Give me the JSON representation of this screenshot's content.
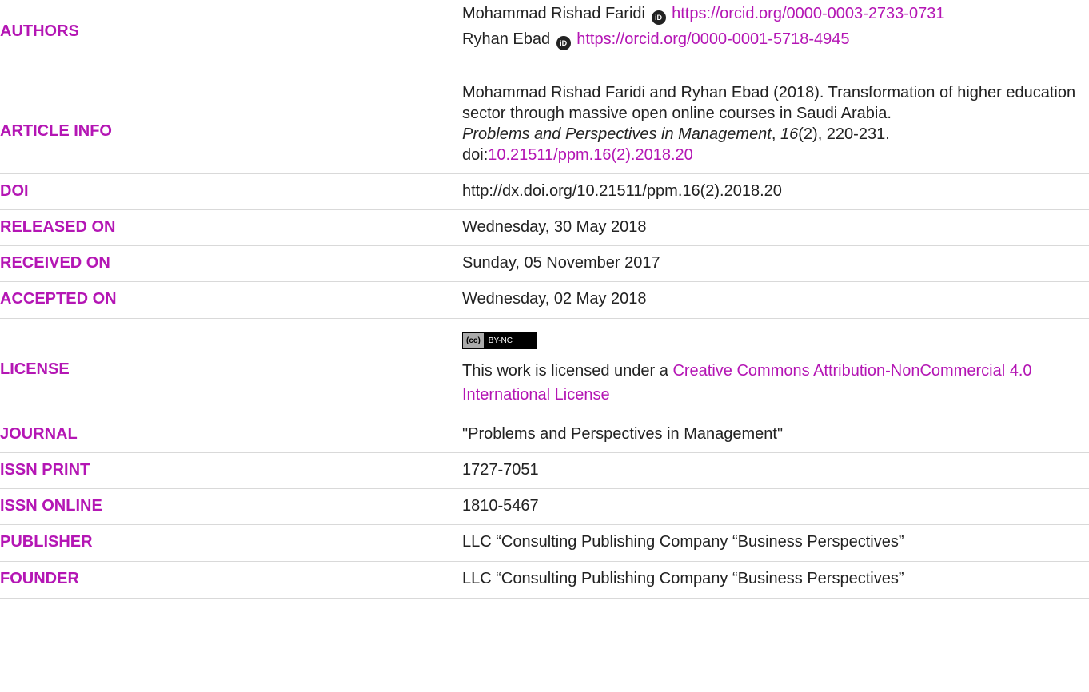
{
  "authors": {
    "label": "AUTHORS",
    "list": [
      {
        "name": "Mohammad Rishad Faridi",
        "orcid_url": "https://orcid.org/0000-0003-2733-0731"
      },
      {
        "name": "Ryhan Ebad",
        "orcid_url": "https://orcid.org/0000-0001-5718-4945"
      }
    ]
  },
  "article_info": {
    "label": "ARTICLE INFO",
    "citation_authors": "Mohammad Rishad Faridi and Ryhan Ebad (2018). Transformation of higher education sector through massive open online courses in Saudi Arabia.",
    "journal_italic": "Problems and Perspectives in Management",
    "comma1": ", ",
    "volume_italic": "16",
    "issue_pages": "(2), 220-231.",
    "doi_prefix": "doi:",
    "doi_link": "10.21511/ppm.16(2).2018.20"
  },
  "doi": {
    "label": "DOI",
    "value": "http://dx.doi.org/10.21511/ppm.16(2).2018.20"
  },
  "released": {
    "label": "RELEASED ON",
    "value": "Wednesday, 30 May 2018"
  },
  "received": {
    "label": "RECEIVED ON",
    "value": "Sunday, 05 November 2017"
  },
  "accepted": {
    "label": "ACCEPTED ON",
    "value": "Wednesday, 02 May 2018"
  },
  "license": {
    "label": "LICENSE",
    "badge_cc": "(cc)",
    "badge_text": "BY-NC",
    "text_prefix": "This work is licensed under a ",
    "link_text": "Creative Commons Attribution-NonCommercial 4.0 International License"
  },
  "journal": {
    "label": "JOURNAL",
    "value": "\"Problems and Perspectives in Management\""
  },
  "issn_print": {
    "label": "ISSN PRINT",
    "value": "1727-7051"
  },
  "issn_online": {
    "label": "ISSN ONLINE",
    "value": "1810-5467"
  },
  "publisher": {
    "label": "PUBLISHER",
    "value": "LLC “Consulting Publishing Company “Business Perspectives”"
  },
  "founder": {
    "label": "FOUNDER",
    "value": "LLC “Consulting Publishing Company “Business Perspectives”"
  },
  "icons": {
    "orcid": "orcid-icon",
    "cc_license": "cc-license-badge"
  },
  "colors": {
    "accent": "#b416b4",
    "text": "#222222",
    "divider": "#d9d9d9"
  }
}
